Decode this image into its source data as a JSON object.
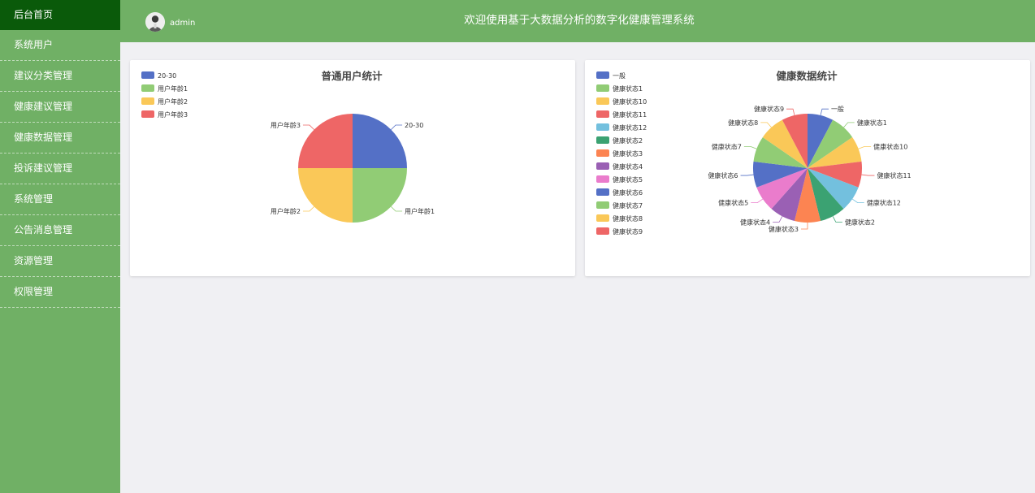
{
  "sidebar": {
    "items": [
      {
        "label": "后台首页",
        "active": true
      },
      {
        "label": "系统用户"
      },
      {
        "label": "建议分类管理"
      },
      {
        "label": "健康建议管理"
      },
      {
        "label": "健康数据管理"
      },
      {
        "label": "投诉建议管理"
      },
      {
        "label": "系统管理"
      },
      {
        "label": "公告消息管理"
      },
      {
        "label": "资源管理"
      },
      {
        "label": "权限管理"
      }
    ]
  },
  "header": {
    "username": "admin",
    "title": "欢迎使用基于大数据分析的数字化健康管理系统",
    "avatar_icon": "user-avatar-icon"
  },
  "chart_data": [
    {
      "type": "pie",
      "title": "普通用户统计",
      "legend_position": "top-left",
      "categories": [
        "20-30",
        "用户年龄1",
        "用户年龄2",
        "用户年龄3"
      ],
      "values": [
        1,
        1,
        1,
        1
      ],
      "colors": [
        "#5470c6",
        "#91cc75",
        "#fac858",
        "#ee6666"
      ]
    },
    {
      "type": "pie",
      "title": "健康数据统计",
      "legend_position": "top-left",
      "categories": [
        "一般",
        "健康状态1",
        "健康状态10",
        "健康状态11",
        "健康状态12",
        "健康状态2",
        "健康状态3",
        "健康状态4",
        "健康状态5",
        "健康状态6",
        "健康状态7",
        "健康状态8",
        "健康状态9"
      ],
      "values": [
        1,
        1,
        1,
        1,
        1,
        1,
        1,
        1,
        1,
        1,
        1,
        1,
        1
      ],
      "colors": [
        "#5470c6",
        "#91cc75",
        "#fac858",
        "#ee6666",
        "#73c0de",
        "#3ba272",
        "#fc8452",
        "#9a60b4",
        "#ea7ccc",
        "#5470c6",
        "#91cc75",
        "#fac858",
        "#ee6666"
      ]
    }
  ]
}
